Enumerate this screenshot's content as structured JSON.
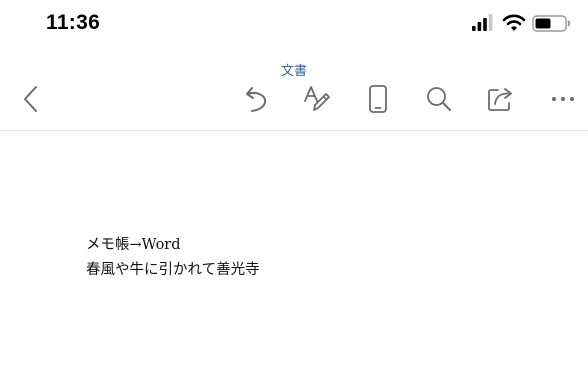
{
  "status_bar": {
    "time": "11:36",
    "icons": [
      "cellular-signal-icon",
      "wifi-icon",
      "battery-icon"
    ]
  },
  "toolbar": {
    "title": "文書",
    "icons": [
      "back-chevron-icon",
      "undo-icon",
      "text-format-icon",
      "mobile-view-icon",
      "search-icon",
      "share-icon",
      "more-icon"
    ],
    "accent_color": "#3b5fa0",
    "icon_color": "#6b6b6b"
  },
  "document": {
    "lines": [
      "メモ帳→Word",
      "春風や牛に引かれて善光寺"
    ]
  }
}
